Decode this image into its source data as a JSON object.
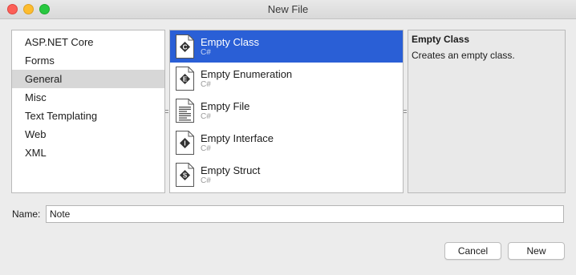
{
  "window": {
    "title": "New File"
  },
  "categories": [
    {
      "label": "ASP.NET Core",
      "selected": false
    },
    {
      "label": "Forms",
      "selected": false
    },
    {
      "label": "General",
      "selected": true
    },
    {
      "label": "Misc",
      "selected": false
    },
    {
      "label": "Text Templating",
      "selected": false
    },
    {
      "label": "Web",
      "selected": false
    },
    {
      "label": "XML",
      "selected": false
    }
  ],
  "templates": [
    {
      "name": "Empty Class",
      "language": "C#",
      "icon": "class-file-icon",
      "glyph": "C",
      "selected": true
    },
    {
      "name": "Empty Enumeration",
      "language": "C#",
      "icon": "enum-file-icon",
      "glyph": "E",
      "selected": false
    },
    {
      "name": "Empty File",
      "language": "C#",
      "icon": "text-file-icon",
      "glyph": "",
      "selected": false
    },
    {
      "name": "Empty Interface",
      "language": "C#",
      "icon": "interface-file-icon",
      "glyph": "I",
      "selected": false
    },
    {
      "name": "Empty Struct",
      "language": "C#",
      "icon": "struct-file-icon",
      "glyph": "S",
      "selected": false
    }
  ],
  "description": {
    "title": "Empty Class",
    "text": "Creates an empty class."
  },
  "name_field": {
    "label": "Name:",
    "value": "Note"
  },
  "buttons": {
    "cancel": "Cancel",
    "new": "New"
  },
  "colors": {
    "selection": "#2a5fd6",
    "close": "#fc5f57",
    "minimize": "#fdbc2e",
    "maximize": "#28c840"
  }
}
